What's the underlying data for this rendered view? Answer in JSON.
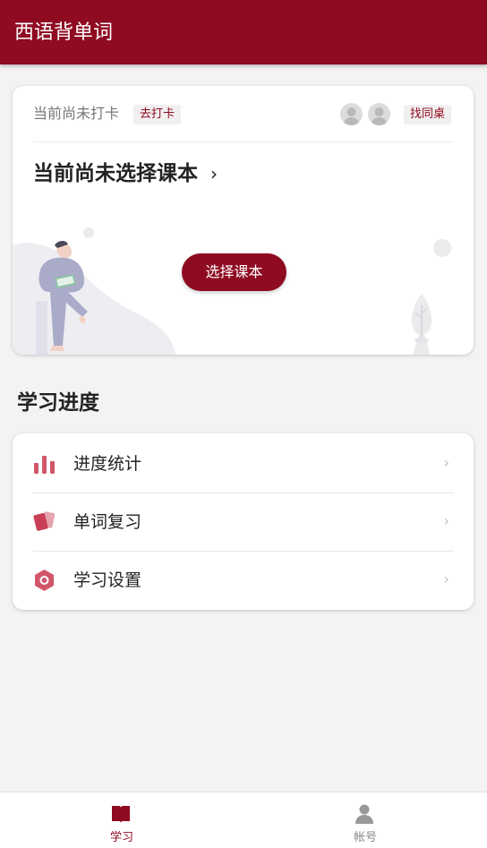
{
  "app": {
    "title": "西语背单词",
    "accent_color": "#8f0b21"
  },
  "study_card": {
    "checkin_status": "当前尚未打卡",
    "checkin_button": "去打卡",
    "find_deskmate_button": "找同桌",
    "avatars": [
      "user-avatar-placeholder",
      "user-avatar-placeholder"
    ],
    "course_title": "当前尚未选择课本",
    "course_chevron": "›",
    "select_book_button": "选择课本"
  },
  "progress_section": {
    "title": "学习进度",
    "items": [
      {
        "label": "进度统计",
        "icon": "bar-chart-icon",
        "chevron": "›"
      },
      {
        "label": "单词复习",
        "icon": "flashcards-icon",
        "chevron": "›"
      },
      {
        "label": "学习设置",
        "icon": "hexagon-settings-icon",
        "chevron": "›"
      }
    ]
  },
  "bottom_nav": {
    "items": [
      {
        "label": "学习",
        "icon": "book-icon",
        "active": true
      },
      {
        "label": "帐号",
        "icon": "user-icon",
        "active": false
      }
    ]
  }
}
